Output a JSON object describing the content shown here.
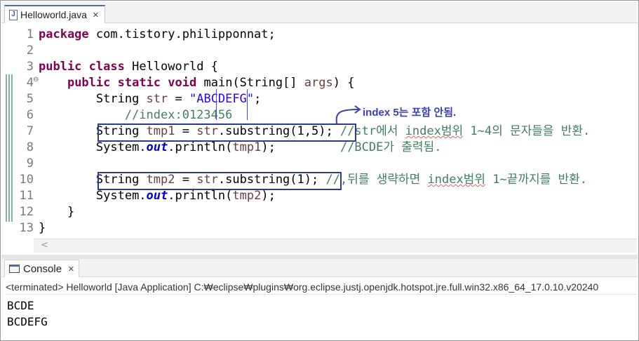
{
  "editor_tab": {
    "icon": "J",
    "title": "Helloworld.java",
    "close": "×"
  },
  "editor": {
    "line_numbers": [
      "1",
      "2",
      "3",
      "4",
      "5",
      "6",
      "7",
      "8",
      "9",
      "10",
      "11",
      "12",
      "13"
    ],
    "fold_marker": "⊖",
    "lines": {
      "l1": {
        "kw": "package",
        "rest": " com.tistory.philipponnat;"
      },
      "l3": {
        "kw1": "public",
        "kw2": "class",
        "rest": " Helloworld {"
      },
      "l4": {
        "indent": "    ",
        "kw1": "public",
        "kw2": "static",
        "kw3": "void",
        "m1": " main(String[] ",
        "arg": "args",
        "m2": ") {"
      },
      "l5": {
        "indent": "        ",
        "t1": "String ",
        "v": "str",
        "t2": " = ",
        "s": "\"ABCDEFG\"",
        "t3": ";"
      },
      "l6": {
        "indent": "            ",
        "c": "//index:0123456"
      },
      "l7": {
        "indent": "        ",
        "t1": "String ",
        "v": "tmp1",
        "t2": " = ",
        "v2": "str",
        "t3": ".substring(1,5);",
        "sp": " ",
        "c1": "//str에서 ",
        "cw": "index범위",
        "c2": " 1~4의 문자들을 반환."
      },
      "l8": {
        "indent": "        ",
        "t1": "System.",
        "f": "out",
        "t2": ".println(",
        "v": "tmp1",
        "t3": ");",
        "sp": "         ",
        "c": "//BCDE가 출력됨."
      },
      "l10": {
        "indent": "        ",
        "t1": "String ",
        "v": "tmp2",
        "t2": " = ",
        "v2": "str",
        "t3": ".substring(1);",
        "sp": " ",
        "c1": "//,뒤를 생략하면 ",
        "cw": "index범위",
        "c2": " 1~끝까지를 반환."
      },
      "l11": {
        "indent": "        ",
        "t1": "System.",
        "f": "out",
        "t2": ".println(",
        "v": "tmp2",
        "t3": ");"
      },
      "l12": {
        "t": "    }"
      },
      "l13": {
        "t": "}"
      }
    },
    "annotation": "index 5는 포함 안됨.",
    "hscroll_arrow": "<",
    "colors": {
      "keyword": "#7f0055",
      "string": "#2a00ff",
      "comment": "#3f7f5f",
      "variable": "#6a3e3e",
      "field": "#0000c0",
      "annotation_box": "#2e3a8c"
    }
  },
  "console": {
    "tab_label": "Console",
    "close": "×",
    "status": "<terminated> Helloworld [Java Application] C:₩eclipse₩plugins₩org.eclipse.justj.openjdk.hotspot.jre.full.win32.x86_64_17.0.10.v20240",
    "output": [
      "BCDE",
      "BCDEFG"
    ]
  }
}
